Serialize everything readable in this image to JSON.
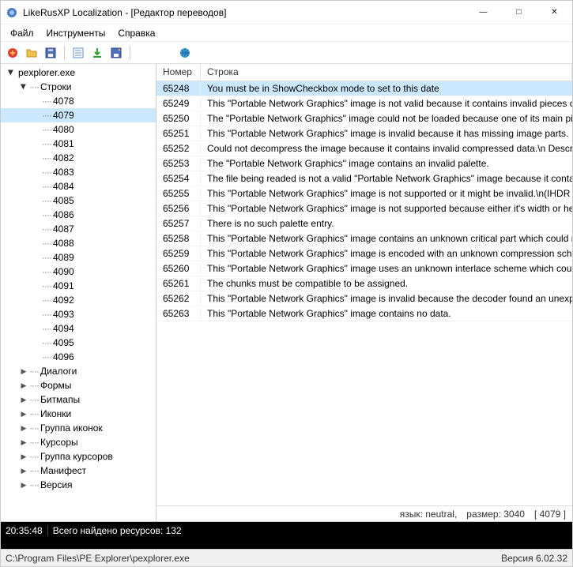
{
  "title": "LikeRusXP Localization - [Редактор переводов]",
  "menu": {
    "file": "Файл",
    "tools": "Инструменты",
    "help": "Справка"
  },
  "tree": {
    "root": "pexplorer.exe",
    "strings_label": "Строки",
    "string_ids": [
      "4078",
      "4079",
      "4080",
      "4081",
      "4082",
      "4083",
      "4084",
      "4085",
      "4086",
      "4087",
      "4088",
      "4089",
      "4090",
      "4091",
      "4092",
      "4093",
      "4094",
      "4095",
      "4096"
    ],
    "selected_id": "4079",
    "sections": {
      "dialogs": "Диалоги",
      "forms": "Формы",
      "bitmaps": "Битмапы",
      "icons": "Иконки",
      "icon_groups": "Группа иконок",
      "cursors": "Курсоры",
      "cursor_groups": "Группа курсоров",
      "manifest": "Манифест",
      "version": "Версия"
    }
  },
  "grid": {
    "col_number": "Номер",
    "col_string": "Строка",
    "rows": [
      {
        "num": "65248",
        "str": "You must be in ShowCheckbox mode to set to this date"
      },
      {
        "num": "65249",
        "str": "This \"Portable Network Graphics\" image is not valid because it contains invalid pieces of data (crc"
      },
      {
        "num": "65250",
        "str": "The \"Portable Network Graphics\" image could not be loaded because one of its main piece of data"
      },
      {
        "num": "65251",
        "str": "This \"Portable Network Graphics\" image is invalid because it has missing image parts."
      },
      {
        "num": "65252",
        "str": "Could not decompress the image because it contains invalid compressed data.\\n Description:"
      },
      {
        "num": "65253",
        "str": "The \"Portable Network Graphics\" image contains an invalid palette."
      },
      {
        "num": "65254",
        "str": "The file being readed is not a valid \"Portable Network Graphics\" image because it contains an inva"
      },
      {
        "num": "65255",
        "str": "This \"Portable Network Graphics\" image is not supported or it might be invalid.\\n(IHDR chunk is no"
      },
      {
        "num": "65256",
        "str": "This \"Portable Network Graphics\" image is not supported because either it's width or height excee"
      },
      {
        "num": "65257",
        "str": "There is no such palette entry."
      },
      {
        "num": "65258",
        "str": "This \"Portable Network Graphics\" image contains an unknown critical part which could not be deco"
      },
      {
        "num": "65259",
        "str": "This \"Portable Network Graphics\" image is encoded with an unknown compression scheme which"
      },
      {
        "num": "65260",
        "str": "This \"Portable Network Graphics\" image uses an unknown interlace scheme which could not be de"
      },
      {
        "num": "65261",
        "str": "The chunks must be compatible to be assigned."
      },
      {
        "num": "65262",
        "str": "This \"Portable Network Graphics\" image is invalid because the decoder found an unexpected end"
      },
      {
        "num": "65263",
        "str": "This \"Portable Network Graphics\" image contains no data."
      }
    ],
    "selected_num": "65248"
  },
  "info": {
    "lang": "язык: neutral,",
    "size": "размер: 3040",
    "id": "[ 4079 ]"
  },
  "console": {
    "time": "20:35:48",
    "msg": "Всего найдено ресурсов: 132"
  },
  "status": {
    "path": "C:\\Program Files\\PE Explorer\\pexplorer.exe",
    "version": "Версия 6.02.32"
  }
}
